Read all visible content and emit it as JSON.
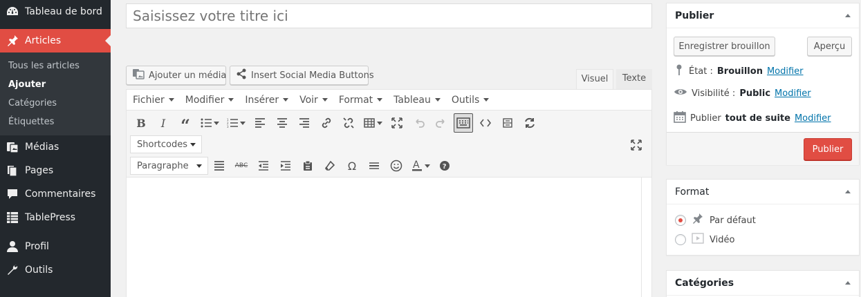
{
  "sidebar": {
    "dashboard": "Tableau de bord",
    "articles": "Articles",
    "submenu": [
      "Tous les articles",
      "Ajouter",
      "Catégories",
      "Étiquettes"
    ],
    "media": "Médias",
    "pages": "Pages",
    "comments": "Commentaires",
    "tablepress": "TablePress",
    "profile": "Profil",
    "tools": "Outils"
  },
  "editor": {
    "title_placeholder": "Saisissez votre titre ici",
    "add_media": "Ajouter un média",
    "social_buttons": "Insert Social Media Buttons",
    "tab_visual": "Visuel",
    "tab_text": "Texte",
    "menubar": [
      "Fichier",
      "Modifier",
      "Insérer",
      "Voir",
      "Format",
      "Tableau",
      "Outils"
    ],
    "shortcodes": "Shortcodes",
    "paragraph": "Paragraphe"
  },
  "publish": {
    "title": "Publier",
    "save_draft": "Enregistrer brouillon",
    "preview": "Aperçu",
    "status_label": "État :",
    "status_value": "Brouillon",
    "visibility_label": "Visibilité :",
    "visibility_value": "Public",
    "publish_label": "Publier",
    "publish_value": "tout de suite",
    "edit_link": "Modifier",
    "publish_button": "Publier"
  },
  "format": {
    "title": "Format",
    "options": [
      "Par défaut",
      "Vidéo"
    ]
  },
  "categories": {
    "title": "Catégories"
  },
  "colors": {
    "sidebar_bg": "#23282d",
    "accent": "#e14d43",
    "link": "#0073aa"
  }
}
